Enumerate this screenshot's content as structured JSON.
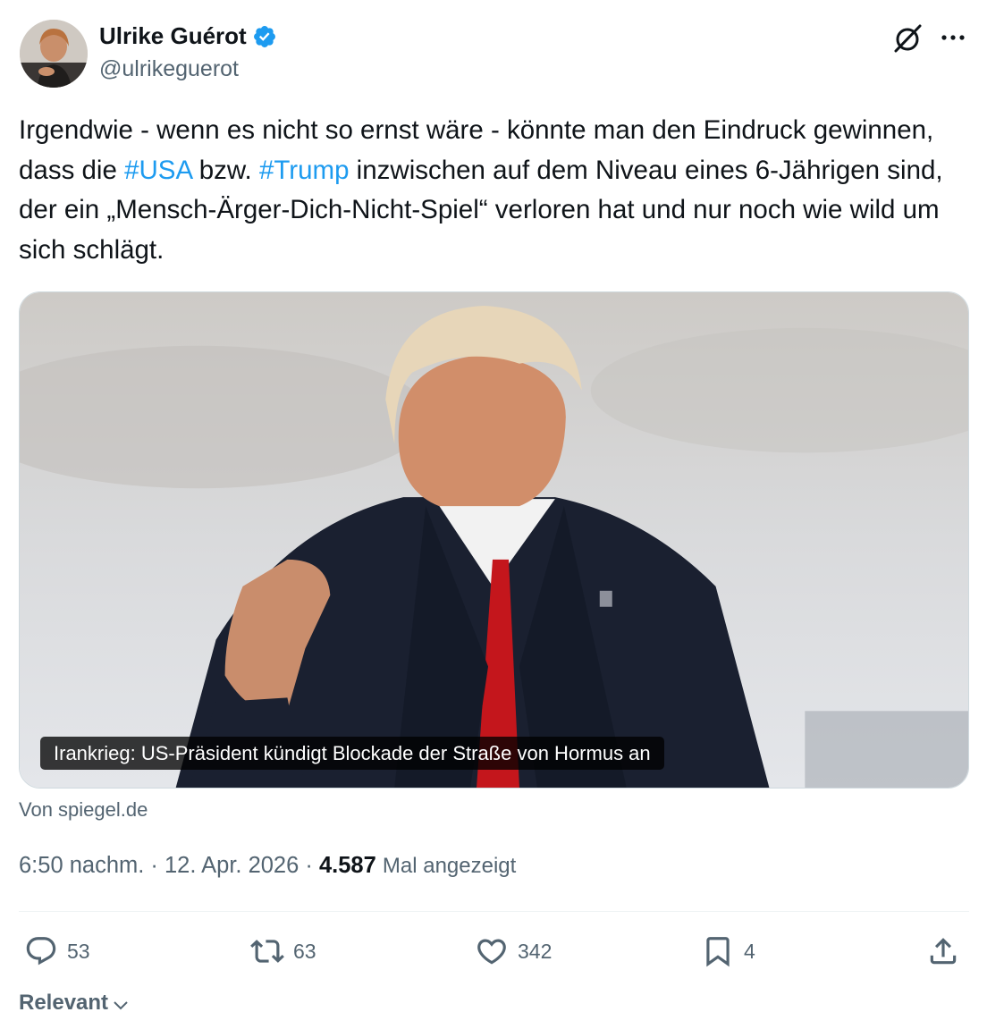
{
  "author": {
    "name": "Ulrike Guérot",
    "handle": "@ulrikeguerot"
  },
  "tweet": {
    "text_1": "Irgendwie - wenn es nicht so ernst wäre - könnte man den Eindruck gewinnen, dass die ",
    "hashtag_1": "#USA",
    "text_2": " bzw. ",
    "hashtag_2": "#Trump",
    "text_3": " inzwischen auf dem Niveau eines 6-Jährigen sind, der ein „Mensch-Ärger-Dich-Nicht-Spiel“ verloren hat und nur noch wie wild um sich schlägt."
  },
  "card": {
    "caption": "Irankrieg: US-Präsident kündigt Blockade der Straße von Hormus an",
    "source": "Von spiegel.de"
  },
  "meta": {
    "timestamp": "6:50 nachm. · 12. Apr. 2026 · ",
    "views_count": "4.587",
    "views_label": "Mal angezeigt"
  },
  "actions": {
    "replies": "53",
    "reposts": "63",
    "likes": "342",
    "bookmarks": "4"
  },
  "sort": {
    "label": "Relevant"
  },
  "icons": {
    "verified": "verified-badge-icon",
    "grok": "grok-icon",
    "more": "more-icon",
    "reply": "reply-icon",
    "repost": "repost-icon",
    "like": "heart-icon",
    "bookmark": "bookmark-icon",
    "share": "share-icon",
    "chevron": "chevron-down-icon"
  },
  "colors": {
    "accent": "#1d9bf0",
    "text": "#0f1419",
    "secondary": "#536471"
  }
}
